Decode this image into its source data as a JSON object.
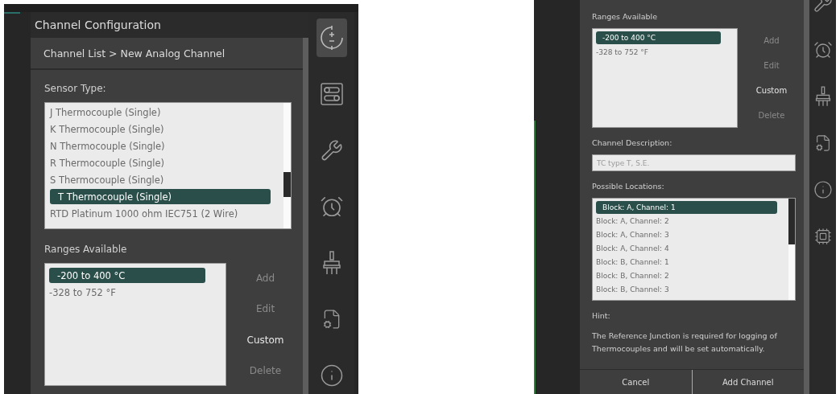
{
  "panes": [
    {
      "title": "Channel Configuration",
      "breadcrumb": "Channel List > New Analog Channel",
      "sidebar": [
        {
          "selected": true
        },
        {
          "selected": false
        },
        {
          "selected": false
        },
        {
          "selected": false
        },
        {
          "selected": false
        },
        {
          "selected": false
        },
        {
          "selected": false
        }
      ],
      "sections": [
        {
          "kind": "list",
          "label": "Sensor Type:",
          "items": [
            {
              "label": "J Thermocouple (Single)",
              "selected": false
            },
            {
              "label": "K Thermocouple (Single)",
              "selected": false
            },
            {
              "label": "N Thermocouple (Single)",
              "selected": false
            },
            {
              "label": "R Thermocouple (Single)",
              "selected": false
            },
            {
              "label": "S Thermocouple (Single)",
              "selected": false
            },
            {
              "label": "T Thermocouple (Single)",
              "selected": true
            },
            {
              "label": "RTD Platinum 1000 ohm IEC751 (2 Wire)",
              "selected": false
            }
          ]
        },
        {
          "kind": "ranges",
          "label": "Ranges Available",
          "items": [
            {
              "label": "-200 to 400 °C",
              "selected": true
            },
            {
              "label": "-328 to 752 °F",
              "selected": false
            }
          ],
          "actions": [
            {
              "label": "Add",
              "disabled": true
            },
            {
              "label": "Edit",
              "disabled": true
            },
            {
              "label": "Custom",
              "disabled": false
            },
            {
              "label": "Delete",
              "disabled": true
            }
          ]
        }
      ]
    },
    {
      "sidebar": [
        {
          "selected": false
        },
        {
          "selected": false
        },
        {
          "selected": false
        },
        {
          "selected": false
        },
        {
          "selected": false
        },
        {
          "selected": false
        }
      ],
      "sections": [
        {
          "kind": "ranges",
          "label": "Ranges Available",
          "items": [
            {
              "label": "-200 to 400 °C",
              "selected": true
            },
            {
              "label": "-328 to 752 °F",
              "selected": false
            }
          ],
          "actions": [
            {
              "label": "Add",
              "disabled": true
            },
            {
              "label": "Edit",
              "disabled": true
            },
            {
              "label": "Custom",
              "disabled": false
            },
            {
              "label": "Delete",
              "disabled": true
            }
          ]
        },
        {
          "kind": "field",
          "label": "Channel Description:",
          "placeholder": "TC type T, S.E."
        },
        {
          "kind": "list",
          "label": "Possible Locations:",
          "items": [
            {
              "label": "Block: A, Channel: 1",
              "selected": true
            },
            {
              "label": "Block: A, Channel: 2",
              "selected": false
            },
            {
              "label": "Block: A, Channel: 3",
              "selected": false
            },
            {
              "label": "Block: A, Channel: 4",
              "selected": false
            },
            {
              "label": "Block: B, Channel: 1",
              "selected": false
            },
            {
              "label": "Block: B, Channel: 2",
              "selected": false
            },
            {
              "label": "Block: B, Channel: 3",
              "selected": false
            }
          ]
        },
        {
          "kind": "hint",
          "label": "Hint:",
          "text": "The Reference Junction is required for logging of Thermocouples and will be set automatically."
        }
      ],
      "buttons": [
        "Cancel",
        "Add Channel"
      ]
    }
  ]
}
